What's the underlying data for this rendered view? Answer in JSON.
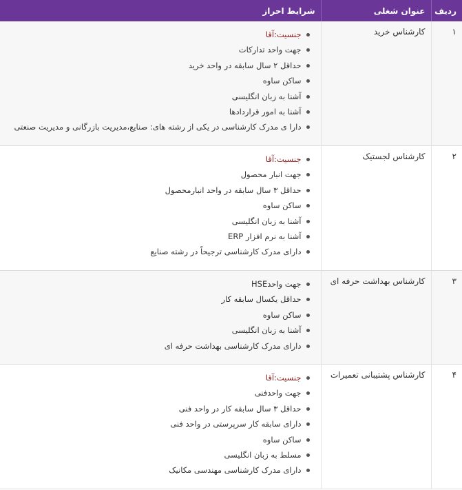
{
  "table": {
    "headers": {
      "index": "ردیف",
      "title": "عنوان شغلی",
      "requirements": "شرایط احراز"
    },
    "rows": [
      {
        "index": "۱",
        "title": "کارشناس خرید",
        "gender_label": "جنسیت:",
        "gender_value": "آقا",
        "requirements": [
          "جهت واحد تدارکات",
          "حداقل ۲ سال سابقه در واحد خرید",
          "ساکن ساوه",
          "آشنا به زبان انگلیسی",
          "آشنا به امور قراردادها",
          "دارا ی مدرک کارشناسی در یکی از رشته های: صنایع،مدیریت بازرگانی و مدیریت صنعتی"
        ]
      },
      {
        "index": "۲",
        "title": "کارشناس لجستیک",
        "gender_label": "جنسیت:",
        "gender_value": "آقا",
        "requirements": [
          "جهت انبار محصول",
          "حداقل ۳ سال سابقه در واحد انبارمحصول",
          "ساکن ساوه",
          "آشنا به زبان انگلیسی",
          "آشنا به نرم افزار ERP",
          "دارای مدرک کارشناسی ترجیحاً در رشته صنایع"
        ]
      },
      {
        "index": "۳",
        "title": "کارشناس بهداشت حرفه ای",
        "gender_label": "",
        "gender_value": "",
        "requirements": [
          "جهت واحدHSE",
          "حداقل یکسال سابقه کار",
          "ساکن ساوه",
          "آشنا به زبان انگلیسی",
          "دارای مدرک کارشناسی بهداشت حرفه ای"
        ]
      },
      {
        "index": "۴",
        "title": "کارشناس پشتیبانی تعمیرات",
        "gender_label": "جنسیت:",
        "gender_value": "آقا",
        "requirements": [
          "جهت واحدفنی",
          "حداقل ۳ سال سابقه کار در واحد فنی",
          "دارای سابقه کار سرپرستی در واحد فنی",
          "ساکن ساوه",
          "مسلط به زبان انگلیسی",
          "دارای مدرک کارشناسی مهندسی مکانیک"
        ]
      }
    ]
  }
}
